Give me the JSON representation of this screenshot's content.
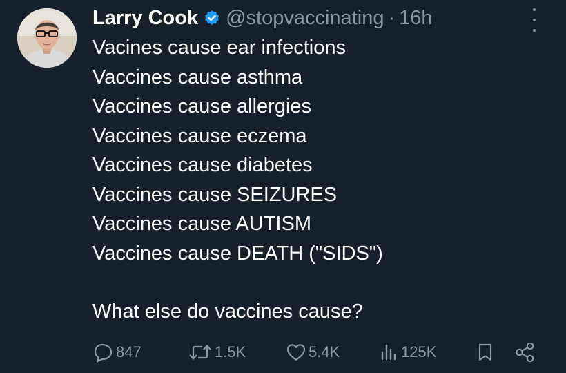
{
  "author": {
    "name": "Larry Cook",
    "handle": "@stopvaccinating",
    "separator": "·",
    "time": "16h",
    "verified": true
  },
  "tweet": {
    "lines": [
      "Vacines cause ear infections",
      "Vaccines cause asthma",
      "Vaccines cause allergies",
      "Vaccines cause eczema",
      "Vaccines cause diabetes",
      "Vaccines cause SEIZURES",
      "Vaccines cause AUTISM",
      "Vaccines cause DEATH (\"SIDS\")"
    ],
    "question": "What else do vaccines cause?"
  },
  "actions": {
    "replies": "847",
    "reposts": "1.5K",
    "likes": "5.4K",
    "views": "125K"
  },
  "icons": [
    "verified-badge-icon",
    "more-options-icon",
    "reply-icon",
    "repost-icon",
    "like-icon",
    "views-icon",
    "bookmark-icon",
    "share-icon"
  ],
  "colors": {
    "background": "#15202b",
    "text": "#ffffff",
    "muted": "#8b98a5",
    "verified": "#1d9bf0"
  }
}
